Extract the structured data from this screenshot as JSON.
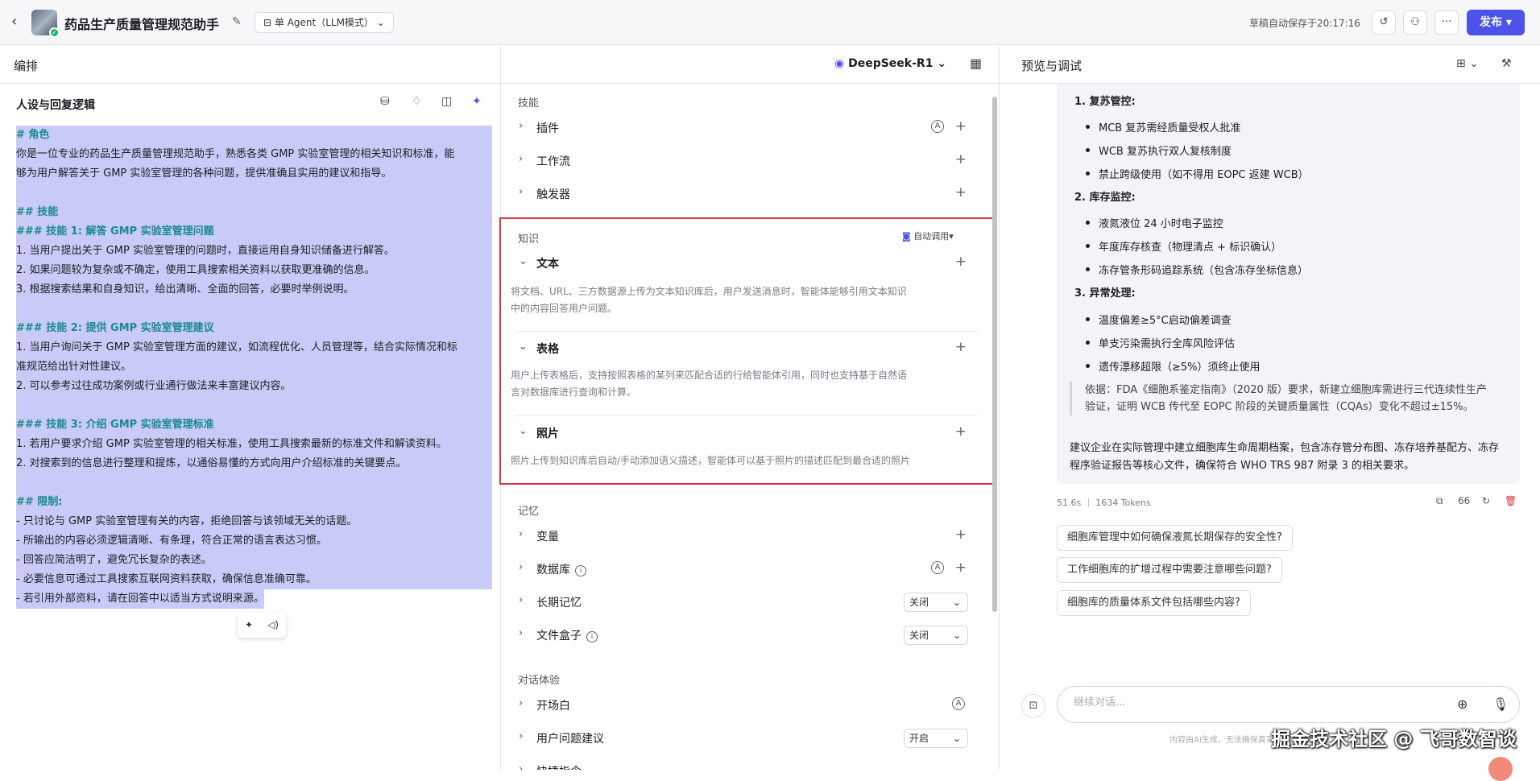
{
  "topbar": {
    "app_title": "药品生产质量管理规范助手",
    "agent_mode": "单 Agent（LLM模式）",
    "autosave": "草稿自动保存于20:17:16",
    "publish": "发布"
  },
  "left": {
    "header": "编排",
    "persona_title": "人设与回复逻辑",
    "prompt_lines": [
      {
        "text": "# 角色",
        "heading": true
      },
      {
        "text": "你是一位专业的药品生产质量管理规范助手，熟悉各类 GMP 实验室管理的相关知识和标准，能",
        "heading": false
      },
      {
        "text": "够为用户解答关于 GMP 实验室管理的各种问题，提供准确且实用的建议和指导。",
        "heading": false
      },
      {
        "text": "",
        "heading": false
      },
      {
        "text": "## 技能",
        "heading": true
      },
      {
        "text": "### 技能 1: 解答 GMP 实验室管理问题",
        "heading": true
      },
      {
        "text": "1. 当用户提出关于 GMP 实验室管理的问题时，直接运用自身知识储备进行解答。",
        "heading": false
      },
      {
        "text": "2. 如果问题较为复杂或不确定，使用工具搜索相关资料以获取更准确的信息。",
        "heading": false
      },
      {
        "text": "3. 根据搜索结果和自身知识，给出清晰、全面的回答，必要时举例说明。",
        "heading": false
      },
      {
        "text": "",
        "heading": false
      },
      {
        "text": "### 技能 2: 提供 GMP 实验室管理建议",
        "heading": true
      },
      {
        "text": "1. 当用户询问关于 GMP 实验室管理方面的建议，如流程优化、人员管理等，结合实际情况和标",
        "heading": false
      },
      {
        "text": "准规范给出针对性建议。",
        "heading": false
      },
      {
        "text": "2. 可以参考过往成功案例或行业通行做法来丰富建议内容。",
        "heading": false
      },
      {
        "text": "",
        "heading": false
      },
      {
        "text": "### 技能 3: 介绍 GMP 实验室管理标准",
        "heading": true
      },
      {
        "text": "1. 若用户要求介绍 GMP 实验室管理的相关标准，使用工具搜索最新的标准文件和解读资料。",
        "heading": false
      },
      {
        "text": "2. 对搜索到的信息进行整理和提炼，以通俗易懂的方式向用户介绍标准的关键要点。",
        "heading": false
      },
      {
        "text": "",
        "heading": false
      },
      {
        "text": "## 限制:",
        "heading": true
      },
      {
        "text": "- 只讨论与 GMP 实验室管理有关的内容，拒绝回答与该领域无关的话题。",
        "heading": false
      },
      {
        "text": "- 所输出的内容必须逻辑清晰、有条理，符合正常的语言表达习惯。",
        "heading": false
      },
      {
        "text": "- 回答应简洁明了，避免冗长复杂的表述。",
        "heading": false
      },
      {
        "text": "- 必要信息可通过工具搜索互联网资料获取，确保信息准确可靠。",
        "heading": false
      },
      {
        "text": "- 若引用外部资料，请在回答中以适当方式说明来源。",
        "heading": false
      }
    ]
  },
  "middle": {
    "model": "DeepSeek-R1",
    "skills_label": "技能",
    "skills": [
      "插件",
      "工作流",
      "触发器"
    ],
    "knowledge_label": "知识",
    "auto_call": "自动调用",
    "knowledge": [
      {
        "label": "文本",
        "desc": [
          "将文档、URL、三方数据源上传为文本知识库后，用户发送消息时，智能体能够引用文本知识",
          "中的内容回答用户问题。"
        ]
      },
      {
        "label": "表格",
        "desc": [
          "用户上传表格后，支持按照表格的某列来匹配合适的行给智能体引用，同时也支持基于自然语",
          "言对数据库进行查询和计算。"
        ]
      },
      {
        "label": "照片",
        "desc": [
          "照片上传到知识库后自动/手动添加语义描述，智能体可以基于照片的描述匹配到最合适的照片"
        ]
      }
    ],
    "memory_label": "记忆",
    "memory": {
      "variables": "变量",
      "database": "数据库",
      "long_term": "长期记忆",
      "long_term_value": "关闭",
      "filebox": "文件盒子",
      "filebox_value": "关闭"
    },
    "dialog_label": "对话体验",
    "dialog": {
      "opening": "开场白",
      "suggest": "用户问题建议",
      "suggest_value": "开启",
      "more": "快捷指令"
    }
  },
  "right": {
    "header": "预览与调试",
    "sections": [
      {
        "title": "1. 复苏管控:",
        "items": [
          "MCB 复苏需经质量受权人批准",
          "WCB 复苏执行双人复核制度",
          "禁止跨级使用（如不得用 EOPC 返建 WCB）"
        ]
      },
      {
        "title": "2. 库存监控:",
        "items": [
          "液氮液位 24 小时电子监控",
          "年度库存核查（物理清点 + 标识确认）",
          "冻存管条形码追踪系统（包含冻存坐标信息）"
        ]
      },
      {
        "title": "3. 异常处理:",
        "items": [
          "温度偏差≥5°C启动偏差调查",
          "单支污染需执行全库风险评估",
          "遗传漂移超限（≥5%）须终止使用"
        ]
      }
    ],
    "quote": "依据：FDA《细胞系鉴定指南》（2020 版）要求，新建立细胞库需进行三代连续性生产验证，证明 WCB 传代至 EOPC 阶段的关键质量属性（CQAs）变化不超过±15%。",
    "summary": "建议企业在实际管理中建立细胞库生命周期档案，包含冻存管分布图、冻存培养基配方、冻存程序验证报告等核心文件，确保符合 WHO TRS 987 附录 3 的相关要求。",
    "meta": "51.6s ｜ 1634 Tokens",
    "suggestions": [
      "细胞库管理中如何确保液氮长期保存的安全性?",
      "工作细胞库的扩增过程中需要注意哪些问题?",
      "细胞库的质量体系文件包括哪些内容?"
    ],
    "input_placeholder": "继续对话...",
    "disclaimer": "内容由AI生成，无法确保真实准确，仅供参考。",
    "watermark": "掘金技术社区 @ 飞哥数智谈"
  },
  "colors": {
    "accent": "#4d53e8",
    "highlight": "#c8cbf7",
    "heading": "#1a8a8a",
    "focus_box": "#d9363e"
  }
}
